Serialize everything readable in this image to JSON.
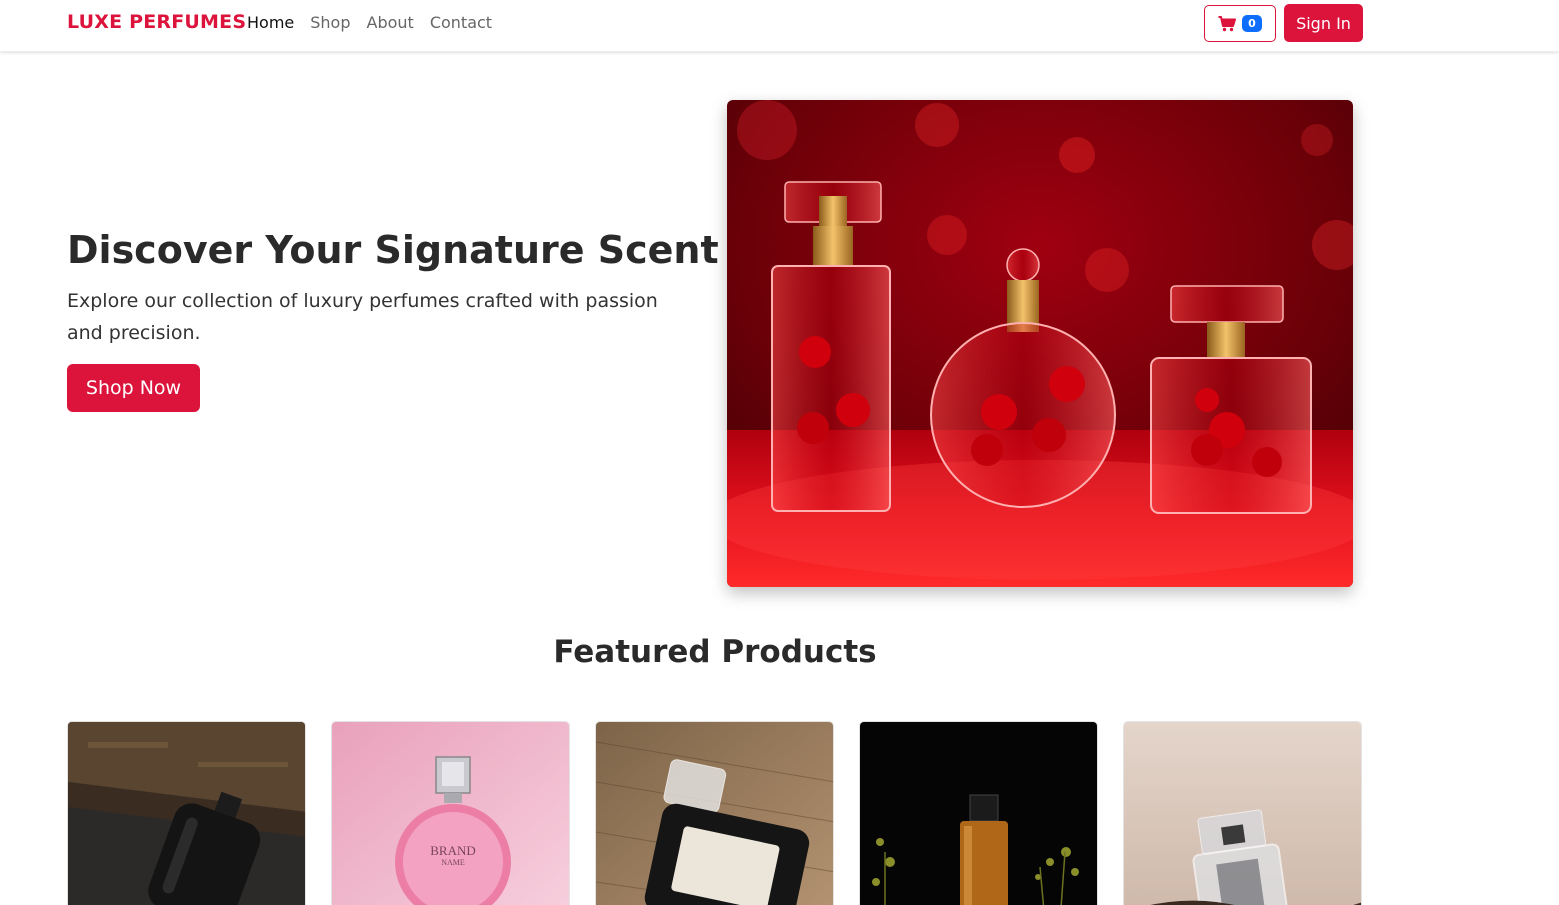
{
  "navbar": {
    "brand": "LUXE PERFUMES",
    "links": [
      "Home",
      "Shop",
      "About",
      "Contact"
    ],
    "active_link": "Home",
    "cart_count": "0",
    "cart_icon": "shopping-cart-icon",
    "sign_in_label": "Sign In"
  },
  "hero": {
    "title": "Discover Your Signature Scent",
    "subtitle": "Explore our collection of luxury perfumes crafted with passion and precision.",
    "cta_label": "Shop Now"
  },
  "featured": {
    "title": "Featured Products",
    "products": [
      {
        "image": "dark-perfume-bottle-on-wood"
      },
      {
        "image": "pink-round-perfume-bottle",
        "label_line1": "BRAND",
        "label_line2": "NAME"
      },
      {
        "image": "black-perfume-bottle-on-fur"
      },
      {
        "image": "amber-perfume-bottle-with-flowers"
      },
      {
        "image": "clear-perfume-bottle-in-soil"
      }
    ]
  },
  "colors": {
    "accent": "#dc143c",
    "badge": "#0d6efd"
  }
}
